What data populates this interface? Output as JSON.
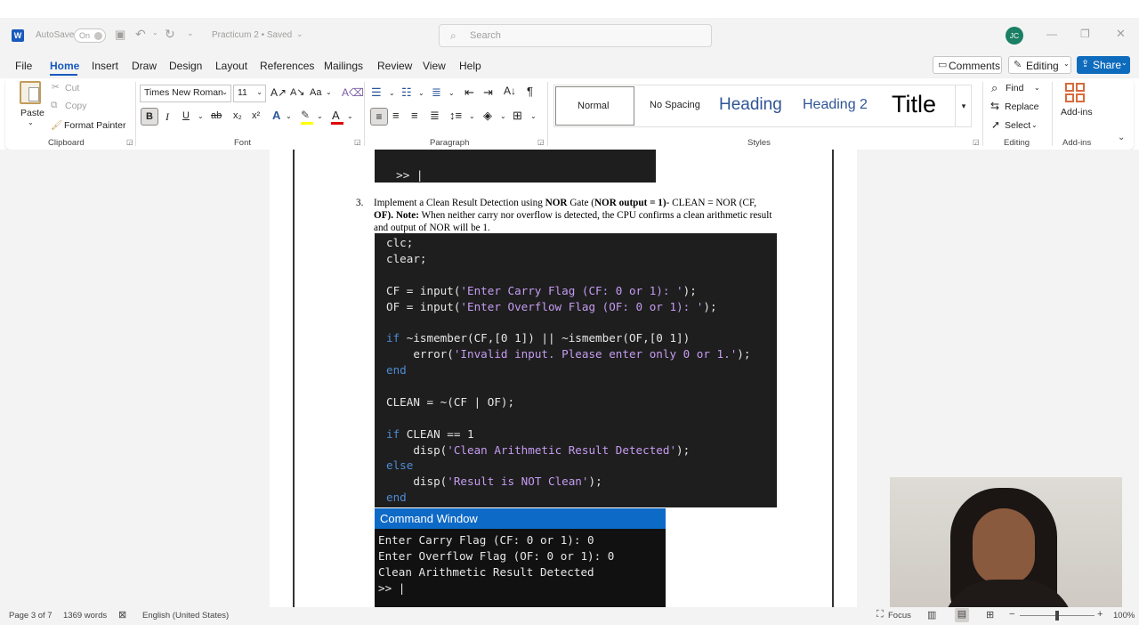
{
  "title_bar": {
    "autosave_label": "AutoSave",
    "autosave_state": "On",
    "doc_title": "Practicum 2 • Saved",
    "search_placeholder": "Search",
    "avatar_initials": "JC"
  },
  "menu": {
    "items": [
      "File",
      "Home",
      "Insert",
      "Draw",
      "Design",
      "Layout",
      "References",
      "Mailings",
      "Review",
      "View",
      "Help"
    ],
    "active": "Home",
    "comments": "Comments",
    "editing": "Editing",
    "share": "Share"
  },
  "ribbon": {
    "clipboard": {
      "paste": "Paste",
      "cut": "Cut",
      "copy": "Copy",
      "format_painter": "Format Painter",
      "label": "Clipboard"
    },
    "font": {
      "name": "Times New Roman",
      "size": "11",
      "label": "Font",
      "case": "Aa"
    },
    "paragraph": {
      "label": "Paragraph"
    },
    "styles": {
      "items": [
        "Normal",
        "No Spacing",
        "Heading",
        "Heading 2",
        "Title"
      ],
      "label": "Styles"
    },
    "editing": {
      "find": "Find",
      "replace": "Replace",
      "select": "Select",
      "label": "Editing"
    },
    "addins": {
      "btn": "Add-ins",
      "label": "Add-ins"
    }
  },
  "document": {
    "top_cmd_prompt": ">> |",
    "item_number": "3.",
    "item_text": {
      "p1": "Implement a Clean Result Detection using ",
      "b1": "NOR",
      "p2": " Gate (",
      "b2": "NOR output = 1)",
      "p3": "- CLEAN = NOR (CF,",
      "line2_b": "OF). Note:",
      "line2": " When neither carry nor overflow is detected, the CPU confirms a clean arithmetic result",
      "line3": "and output of NOR will be 1."
    },
    "code_lines": [
      {
        "k": "",
        "t": "clc;",
        "s": "",
        "e": ""
      },
      {
        "k": "",
        "t": "clear;",
        "s": "",
        "e": ""
      },
      {
        "k": "",
        "t": "",
        "s": "",
        "e": ""
      },
      {
        "k": "",
        "t": "CF = input(",
        "s": "'Enter Carry Flag (CF: 0 or 1): '",
        "e": ");"
      },
      {
        "k": "",
        "t": "OF = input(",
        "s": "'Enter Overflow Flag (OF: 0 or 1): '",
        "e": ");"
      },
      {
        "k": "",
        "t": "",
        "s": "",
        "e": ""
      },
      {
        "k": "if",
        "t": " ~ismember(CF,[0 1]) || ~ismember(OF,[0 1])",
        "s": "",
        "e": ""
      },
      {
        "k": "",
        "t": "    error(",
        "s": "'Invalid input. Please enter only 0 or 1.'",
        "e": ");"
      },
      {
        "k": "end",
        "t": "",
        "s": "",
        "e": ""
      },
      {
        "k": "",
        "t": "",
        "s": "",
        "e": ""
      },
      {
        "k": "",
        "t": "CLEAN = ~(CF | OF);",
        "s": "",
        "e": ""
      },
      {
        "k": "",
        "t": "",
        "s": "",
        "e": ""
      },
      {
        "k": "if",
        "t": " CLEAN == 1",
        "s": "",
        "e": ""
      },
      {
        "k": "",
        "t": "    disp(",
        "s": "'Clean Arithmetic Result Detected'",
        "e": ");"
      },
      {
        "k": "else",
        "t": "",
        "s": "",
        "e": ""
      },
      {
        "k": "",
        "t": "    disp(",
        "s": "'Result is NOT Clean'",
        "e": ");"
      },
      {
        "k": "end",
        "t": "",
        "s": "",
        "e": ""
      }
    ],
    "command_window": {
      "title": "Command Window",
      "lines": [
        "Enter Carry Flag (CF: 0 or 1): 0",
        "Enter Overflow Flag (OF: 0 or 1): 0",
        "Clean Arithmetic Result Detected",
        ">> |"
      ]
    }
  },
  "status": {
    "page": "Page 3 of 7",
    "words": "1369 words",
    "language": "English (United States)",
    "focus": "Focus",
    "zoom": "100%"
  },
  "colors": {
    "accent": "#185abd",
    "share": "#0f6cbd",
    "avatar": "#1a7f64",
    "cmd_title": "#0e6ac7",
    "code_bg": "#1e1e1e",
    "keyword": "#4e8ad4",
    "string": "#c59cf2"
  }
}
